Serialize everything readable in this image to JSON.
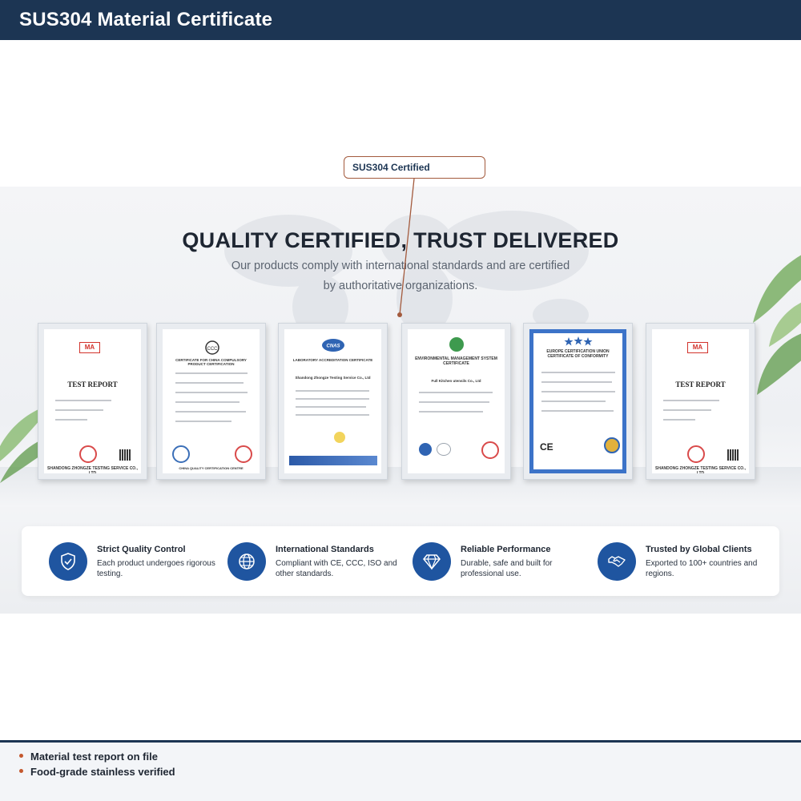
{
  "header": {
    "title": "SUS304 Material Certificate"
  },
  "callout": {
    "label": "SUS304 Certified"
  },
  "banner": {
    "headline": "QUALITY CERTIFIED, TRUST DELIVERED",
    "subtitle_line1": "Our products comply with international standards and are certified",
    "subtitle_line2": "by authoritative organizations."
  },
  "certificates": [
    {
      "title": "TEST REPORT",
      "badge": "MA",
      "footer": "SHANDONG ZHONGZE TESTING SERVICE CO., LTD"
    },
    {
      "title": "CERTIFICATE FOR CHINA COMPULSORY PRODUCT CERTIFICATION",
      "badge": "CCC",
      "footer": "CHINA QUALITY CERTIFICATION CENTRE"
    },
    {
      "title": "LABORATORY ACCREDITATION CERTIFICATE",
      "badge": "CNAS",
      "footer": "Shandong Zhongze Testing Service Co., Ltd"
    },
    {
      "title": "ENVIRONMENTAL MANAGEMENT SYSTEM CERTIFICATE",
      "badge": "",
      "footer": "Full Kitchen utensils Co., Ltd"
    },
    {
      "title": "EUROPE CERTIFICATION UNION CERTIFICATE OF CONFORMITY",
      "badge": "CE",
      "footer": ""
    },
    {
      "title": "TEST REPORT",
      "badge": "MA",
      "footer": "SHANDONG ZHONGZE TESTING SERVICE CO., LTD"
    }
  ],
  "features": [
    {
      "icon": "shield-check-icon",
      "title": "Strict Quality Control",
      "desc": "Each product undergoes rigorous testing."
    },
    {
      "icon": "globe-icon",
      "title": "International Standards",
      "desc": "Compliant with CE, CCC, ISO and other standards."
    },
    {
      "icon": "diamond-icon",
      "title": "Reliable Performance",
      "desc": "Durable, safe and built for professional use."
    },
    {
      "icon": "handshake-icon",
      "title": "Trusted by Global Clients",
      "desc": "Exported to 100+ countries and regions."
    }
  ],
  "bullets": [
    "Material test report on file",
    "Food-grade stainless verified"
  ],
  "colors": {
    "header_bg": "#1c3553",
    "accent_icon": "#1f55a0",
    "bullet_dot": "#c4582e",
    "callout_border": "#a35a3d"
  }
}
